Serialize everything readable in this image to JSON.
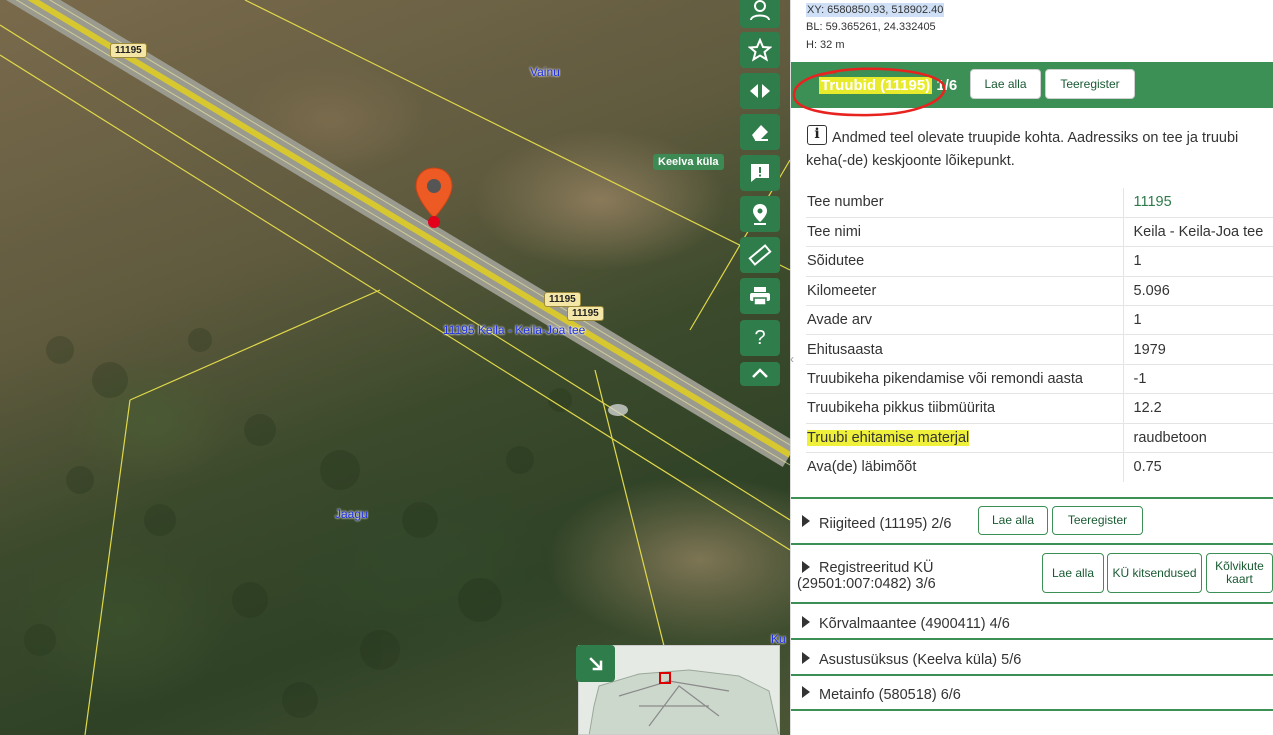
{
  "map": {
    "road_numbers": [
      "11195",
      "11195",
      "11195"
    ],
    "road_name": "11195 Keila - Keila-Joa tee",
    "places": {
      "vainu": "Vainu",
      "keelva": "Keelva küla",
      "jaagu": "Jaagu",
      "ku": "Ku"
    }
  },
  "toolbar": {
    "icons": [
      "user-icon",
      "star-icon",
      "swap-icon",
      "eraser-icon",
      "feedback-icon",
      "location-icon",
      "ruler-icon",
      "print-icon",
      "help-icon",
      "chevron-up-icon"
    ],
    "help_label": "?"
  },
  "panel": {
    "coords": {
      "xy": "XY: 6580850.93, 518902.40",
      "bl": "BL: 59.365261, 24.332405",
      "h": "H: 32 m"
    },
    "section": {
      "title_main": "Truubid (11195)",
      "title_count": " 1/6",
      "btn_download": "Lae alla",
      "btn_register": "Teeregister"
    },
    "info_icon": "i",
    "info_text": "Andmed teel olevate truupide kohta. Aadressiks on tee ja truubi keha(-de) keskjoonte lõikepunkt.",
    "attributes": [
      {
        "key": "Tee number",
        "value": "11195"
      },
      {
        "key": "Tee nimi",
        "value": "Keila - Keila-Joa tee"
      },
      {
        "key": "Sõidutee",
        "value": "1"
      },
      {
        "key": "Kilomeeter",
        "value": "5.096"
      },
      {
        "key": "Avade arv",
        "value": "1"
      },
      {
        "key": "Ehitusaasta",
        "value": "1979"
      },
      {
        "key": "Truubikeha pikendamise või remondi aasta",
        "value": "-1"
      },
      {
        "key": "Truubikeha pikkus tiibmüürita",
        "value": "12.2"
      },
      {
        "key": "Truubi ehitamise materjal",
        "value": "raudbetoon"
      },
      {
        "key": "Ava(de) läbimõõt",
        "value": "0.75"
      }
    ],
    "collapsed": {
      "riigiteed": "Riigiteed (11195) 2/6",
      "riigiteed_btn1": "Lae alla",
      "riigiteed_btn2": "Teeregister",
      "ky_line1": "Registreeritud KÜ",
      "ky_line2": "(29501:007:0482) 3/6",
      "ky_btn1": "Lae alla",
      "ky_btn2": "KÜ kitsendused",
      "ky_btn3": "Kõlvikute kaart",
      "korval": "Kõrvalmaantee (4900411) 4/6",
      "asustus": "Asustusüksus (Keelva küla) 5/6",
      "meta": "Metainfo (580518) 6/6"
    },
    "colors": {
      "accent": "#3c8f55",
      "highlight": "#eef03a",
      "annotation": "#e8231f"
    }
  }
}
